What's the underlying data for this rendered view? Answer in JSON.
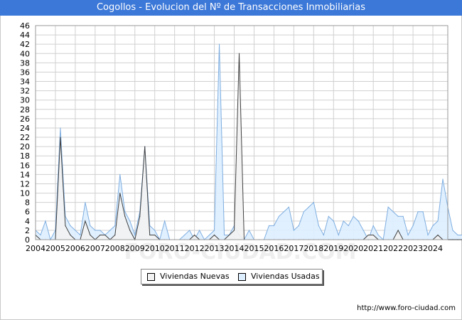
{
  "title": "Cogollos - Evolucion del Nº de Transacciones Inmobiliarias",
  "footer": {
    "url": "http://www.foro-ciudad.com"
  },
  "watermark": "FORO-CIUDAD.COM",
  "legend": {
    "nuevas": "Viviendas Nuevas",
    "usadas": "Viviendas Usadas"
  },
  "colors": {
    "title_bg": "#3c78d8",
    "nuevas_fill": "#f2f2f2",
    "nuevas_line": "#404040",
    "usadas_fill": "#ddeeff",
    "usadas_line": "#7faee0",
    "grid": "#d0d0d0"
  },
  "chart_data": {
    "type": "area",
    "title": "Cogollos - Evolucion del Nº de Transacciones Inmobiliarias",
    "xlabel": "",
    "ylabel": "",
    "ylim": [
      0,
      46
    ],
    "yticks": [
      0,
      2,
      4,
      6,
      8,
      10,
      12,
      14,
      16,
      18,
      20,
      22,
      24,
      26,
      28,
      30,
      32,
      34,
      36,
      38,
      40,
      42,
      44,
      46
    ],
    "xticks": [
      "2004",
      "2005",
      "2006",
      "2007",
      "2008",
      "2009",
      "2010",
      "2011",
      "2012",
      "2013",
      "2014",
      "2015",
      "2016",
      "2017",
      "2018",
      "2019",
      "2020",
      "2021",
      "2022",
      "2023",
      "2024"
    ],
    "grid": true,
    "legend_position": "bottom-center",
    "periodicity": "quarterly, 2004 Q1 to 2024 Q4",
    "series": [
      {
        "name": "Viviendas Nuevas",
        "values": [
          1,
          0,
          0,
          0,
          0,
          22,
          3,
          1,
          0,
          0,
          4,
          1,
          0,
          1,
          1,
          0,
          1,
          10,
          5,
          2,
          0,
          5,
          20,
          1,
          1,
          0,
          0,
          0,
          0,
          0,
          0,
          0,
          1,
          0,
          0,
          0,
          1,
          0,
          0,
          1,
          2,
          40,
          0,
          0,
          0,
          0,
          0,
          0,
          0,
          0,
          0,
          0,
          0,
          0,
          0,
          0,
          0,
          0,
          0,
          0,
          0,
          0,
          0,
          0,
          0,
          0,
          0,
          1,
          1,
          0,
          0,
          0,
          0,
          2,
          0,
          0,
          0,
          0,
          0,
          0,
          0,
          1,
          0,
          0,
          0,
          0,
          0,
          0,
          0,
          0,
          0,
          0,
          0,
          0,
          0,
          0,
          0,
          0,
          0,
          0,
          0,
          1,
          0,
          0,
          0,
          0,
          0,
          0,
          0,
          0,
          0,
          0,
          0,
          0,
          0,
          0,
          0,
          1,
          0,
          0,
          0,
          0,
          0,
          0,
          0,
          0,
          0,
          0,
          0,
          0,
          1,
          0,
          0,
          0,
          0,
          0
        ]
      },
      {
        "name": "Viviendas Usadas",
        "values": [
          2,
          1,
          4,
          0,
          2,
          24,
          5,
          3,
          2,
          1,
          8,
          3,
          2,
          2,
          1,
          2,
          3,
          14,
          6,
          4,
          1,
          6,
          20,
          3,
          2,
          0,
          4,
          0,
          0,
          0,
          1,
          2,
          0,
          2,
          0,
          1,
          2,
          42,
          1,
          1,
          3,
          1,
          0,
          2,
          0,
          0,
          0,
          3,
          3,
          5,
          6,
          7,
          2,
          3,
          6,
          7,
          8,
          3,
          1,
          5,
          4,
          1,
          4,
          3,
          5,
          4,
          2,
          0,
          3,
          1,
          0,
          7,
          6,
          5,
          5,
          1,
          3,
          6,
          6,
          1,
          3,
          4,
          13,
          7,
          2,
          1,
          1,
          3
        ]
      }
    ]
  }
}
